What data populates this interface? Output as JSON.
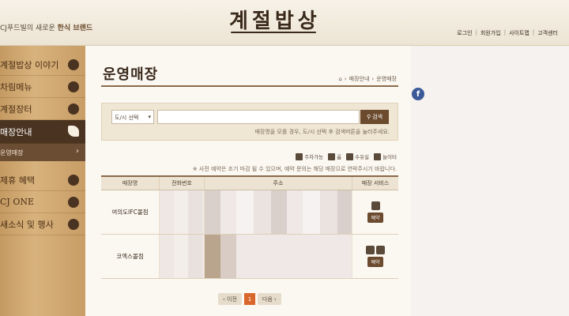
{
  "header": {
    "brand_tag_prefix": "CJ푸드빌의 새로운",
    "brand_tag_bold": "한식 브랜드",
    "logo": "계절밥상",
    "nav": [
      "로그인",
      "회원가입",
      "사이트맵",
      "고객센터"
    ]
  },
  "sidebar": {
    "items": [
      {
        "label": "계절밥상 이야기"
      },
      {
        "label": "차림메뉴"
      },
      {
        "label": "계절장터"
      },
      {
        "label": "매장안내"
      },
      {
        "label": "제휴 혜택"
      },
      {
        "label": "CJ ONE"
      },
      {
        "label": "새소식 및 행사"
      }
    ],
    "sub_active": "운영매장"
  },
  "page": {
    "title": "운영매장",
    "breadcrumb": [
      "매장안내",
      "운영매장"
    ]
  },
  "search": {
    "select_value": "도/시 선택",
    "button_label": "검색",
    "hint": "매장명을 모를 경우, 도/시 선택 후 검색버튼을 눌러주세요."
  },
  "legend": [
    "주차가능",
    "룸",
    "수유실",
    "놀이터"
  ],
  "notice": "※ 사전 예약은 조기 마감 될 수 있으며, 예약 문의는 해당 매장으로 연락주시기 바랍니다.",
  "table": {
    "headers": [
      "매장명",
      "전화번호",
      "주소",
      "매장 서비스"
    ],
    "rows": [
      {
        "name": "여의도IFC몰점",
        "reserve": "예약"
      },
      {
        "name": "코엑스몰점",
        "reserve": "예약"
      }
    ]
  },
  "pager": {
    "prev": "이전",
    "current": "1",
    "next": "다음"
  },
  "social": {
    "facebook": "f"
  },
  "colors": {
    "accent": "#6b4a2e",
    "active_page": "#d9662a",
    "sidebar_active": "#4a3320"
  }
}
